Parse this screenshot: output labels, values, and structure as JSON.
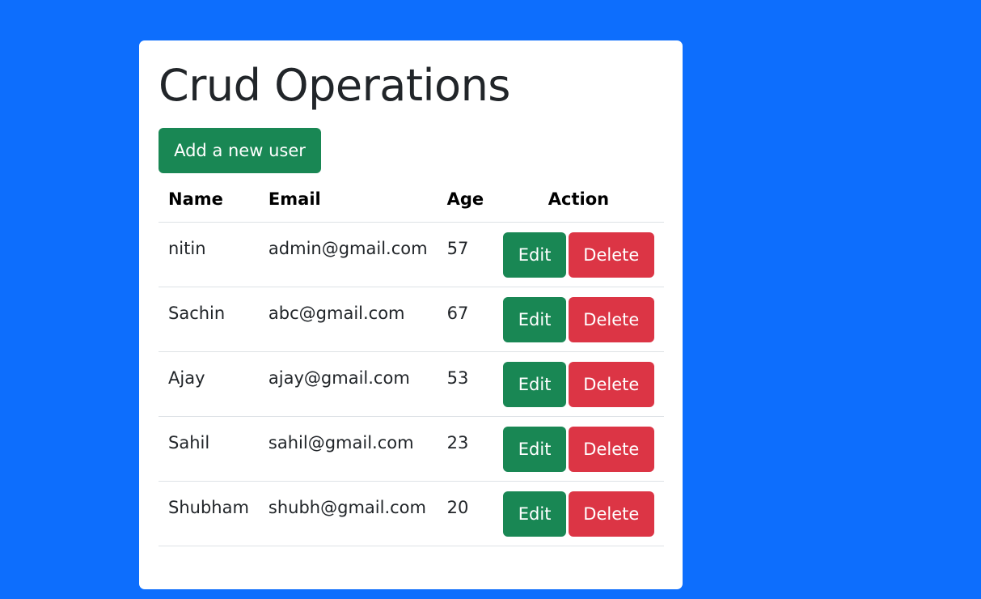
{
  "page": {
    "title": "Crud Operations",
    "add_button_label": "Add a new user"
  },
  "table": {
    "headers": {
      "name": "Name",
      "email": "Email",
      "age": "Age",
      "action": "Action"
    },
    "rows": [
      {
        "name": "nitin",
        "email": "admin@gmail.com",
        "age": "57",
        "edit_label": "Edit",
        "delete_label": "Delete"
      },
      {
        "name": "Sachin",
        "email": "abc@gmail.com",
        "age": "67",
        "edit_label": "Edit",
        "delete_label": "Delete"
      },
      {
        "name": "Ajay",
        "email": "ajay@gmail.com",
        "age": "53",
        "edit_label": "Edit",
        "delete_label": "Delete"
      },
      {
        "name": "Sahil",
        "email": "sahil@gmail.com",
        "age": "23",
        "edit_label": "Edit",
        "delete_label": "Delete"
      },
      {
        "name": "Shubham",
        "email": "shubh@gmail.com",
        "age": "20",
        "edit_label": "Edit",
        "delete_label": "Delete"
      }
    ]
  },
  "colors": {
    "background": "#0d6efd",
    "success": "#198754",
    "danger": "#dc3545"
  }
}
